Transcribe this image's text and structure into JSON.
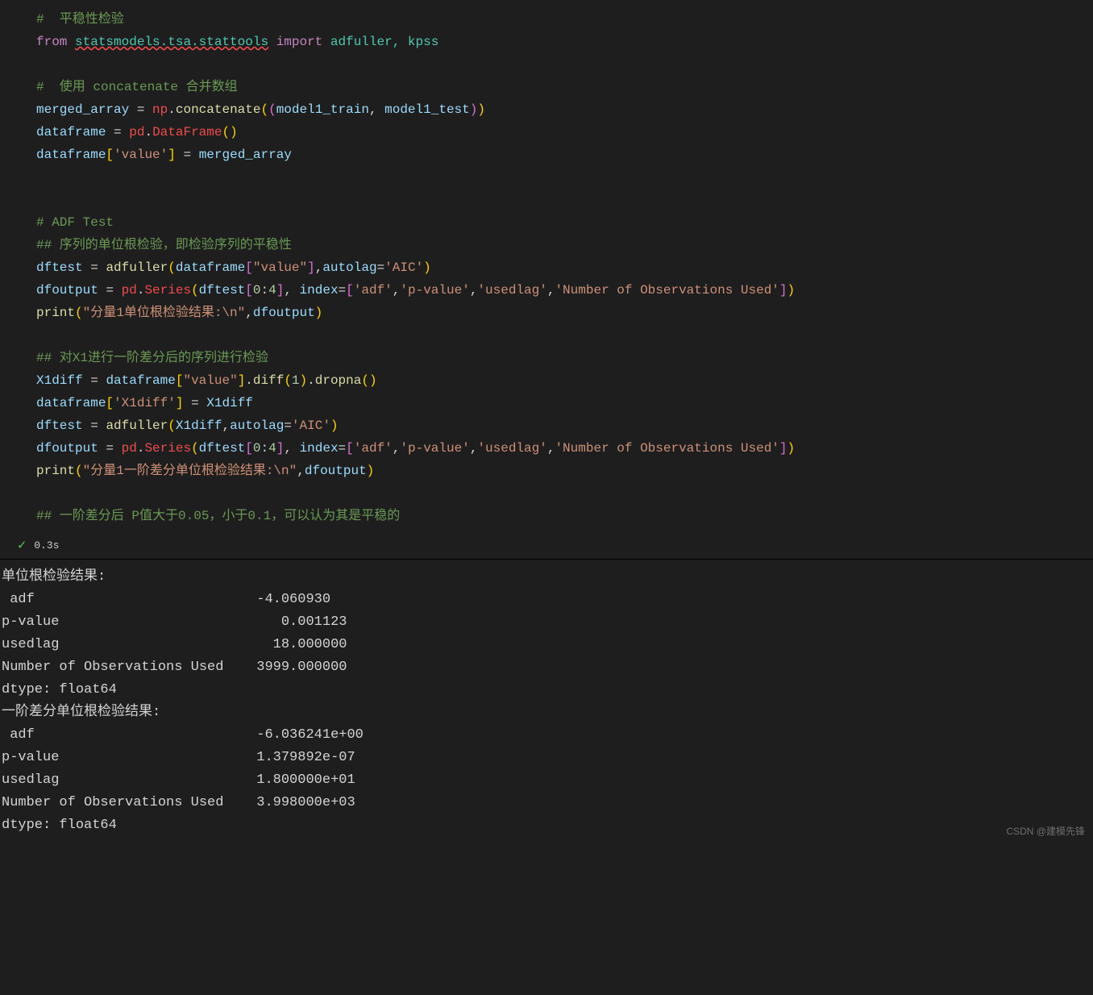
{
  "code": {
    "l1_comment": "#  平稳性检验",
    "l2_from": "from",
    "l2_mod": "statsmodels.tsa.stattools",
    "l2_import": "import",
    "l2_names": "adfuller, kpss",
    "l4_comment": "#  使用 concatenate 合并数组",
    "l5_lhs": "merged_array",
    "l5_np": "np",
    "l5_concat": "concatenate",
    "l5_arg1": "model1_train",
    "l5_arg2": "model1_test",
    "l6_lhs": "dataframe",
    "l6_pd": "pd",
    "l6_df": "DataFrame",
    "l7_lhs": "dataframe",
    "l7_key": "'value'",
    "l7_rhs": "merged_array",
    "l10_comment": "# ADF Test",
    "l11_comment": "## 序列的单位根检验，即检验序列的平稳性",
    "l12_lhs": "dftest",
    "l12_fn": "adfuller",
    "l12_df": "dataframe",
    "l12_key": "\"value\"",
    "l12_autolag": "autolag",
    "l12_aic": "'AIC'",
    "l13_lhs": "dfoutput",
    "l13_pd": "pd",
    "l13_series": "Series",
    "l13_dftest": "dftest",
    "l13_n0": "0",
    "l13_n4": "4",
    "l13_index": "index",
    "l13_s1": "'adf'",
    "l13_s2": "'p-value'",
    "l13_s3": "'usedlag'",
    "l13_s4": "'Number of Observations Used'",
    "l14_print": "print",
    "l14_str": "\"分量1单位根检验结果:\\n\"",
    "l14_arg": "dfoutput",
    "l16_comment": "## 对X1进行一阶差分后的序列进行检验",
    "l17_lhs": "X1diff",
    "l17_df": "dataframe",
    "l17_key": "\"value\"",
    "l17_diff": "diff",
    "l17_n1": "1",
    "l17_dropna": "dropna",
    "l18_df": "dataframe",
    "l18_key": "'X1diff'",
    "l18_rhs": "X1diff",
    "l19_lhs": "dftest",
    "l19_fn": "adfuller",
    "l19_arg": "X1diff",
    "l19_autolag": "autolag",
    "l19_aic": "'AIC'",
    "l20_lhs": "dfoutput",
    "l20_pd": "pd",
    "l20_series": "Series",
    "l20_dftest": "dftest",
    "l20_n0": "0",
    "l20_n4": "4",
    "l20_index": "index",
    "l20_s1": "'adf'",
    "l20_s2": "'p-value'",
    "l20_s3": "'usedlag'",
    "l20_s4": "'Number of Observations Used'",
    "l21_print": "print",
    "l21_str": "\"分量1一阶差分单位根检验结果:\\n\"",
    "l21_arg": "dfoutput",
    "l23_comment": "## 一阶差分后 P值大于0.05，小于0.1，可以认为其是平稳的"
  },
  "status": {
    "time": "0.3s"
  },
  "output": {
    "h1": "单位根检验结果:",
    "r1": " adf                           -4.060930",
    "r2": "p-value                           0.001123",
    "r3": "usedlag                          18.000000",
    "r4": "Number of Observations Used    3999.000000",
    "r5": "dtype: float64",
    "h2": "一阶差分单位根检验结果:",
    "r6": " adf                           -6.036241e+00",
    "r7": "p-value                        1.379892e-07",
    "r8": "usedlag                        1.800000e+01",
    "r9": "Number of Observations Used    3.998000e+03",
    "r10": "dtype: float64"
  },
  "watermark": "CSDN @建模先锋"
}
